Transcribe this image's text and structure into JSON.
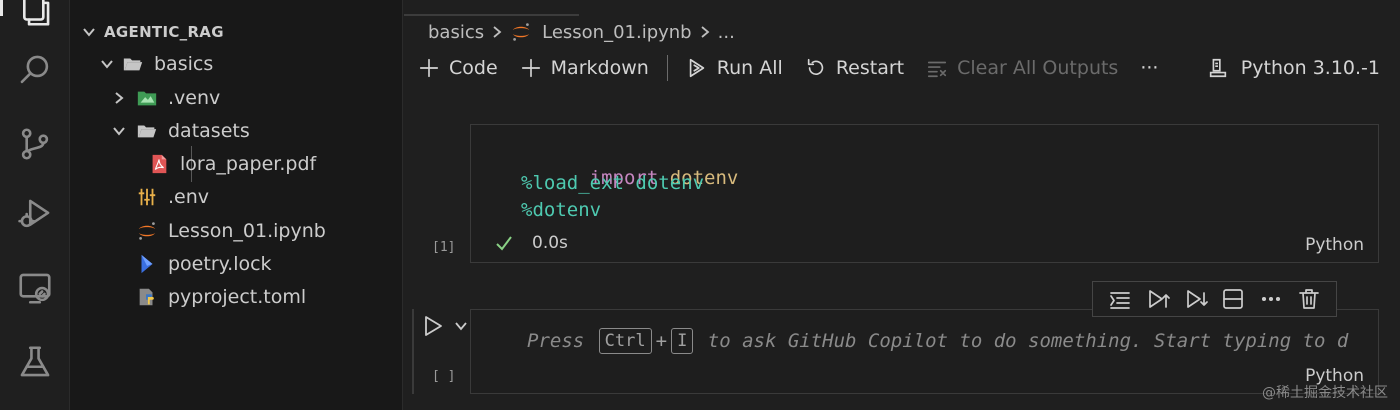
{
  "explorer": {
    "section_title": "AGENTIC_RAG",
    "items": [
      {
        "label": "basics"
      },
      {
        "label": ".venv"
      },
      {
        "label": "datasets"
      },
      {
        "label": "lora_paper.pdf"
      },
      {
        "label": ".env"
      },
      {
        "label": "Lesson_01.ipynb"
      },
      {
        "label": "poetry.lock"
      },
      {
        "label": "pyproject.toml"
      }
    ]
  },
  "breadcrumb": {
    "folder": "basics",
    "file": "Lesson_01.ipynb",
    "more": "..."
  },
  "toolbar": {
    "code_label": "Code",
    "markdown_label": "Markdown",
    "run_all_label": "Run All",
    "restart_label": "Restart",
    "clear_outputs_label": "Clear All Outputs",
    "more_label": "···",
    "kernel_label": "Python 3.10.-1"
  },
  "cells": [
    {
      "execution_count": "[1]",
      "lines": [
        {
          "keyword": "import",
          "module": "dotenv"
        },
        {
          "text": "%load_ext dotenv"
        },
        {
          "text": "%dotenv"
        }
      ],
      "status_time": "0.0s",
      "language": "Python"
    },
    {
      "execution_count": "[ ]",
      "placeholder_prefix": "Press",
      "key1": "Ctrl",
      "plus": "+",
      "key2": "I",
      "placeholder_suffix": "to ask GitHub Copilot to do something. Start typing to d",
      "language": "Python"
    }
  ],
  "watermark": "@稀土掘金技术社区"
}
